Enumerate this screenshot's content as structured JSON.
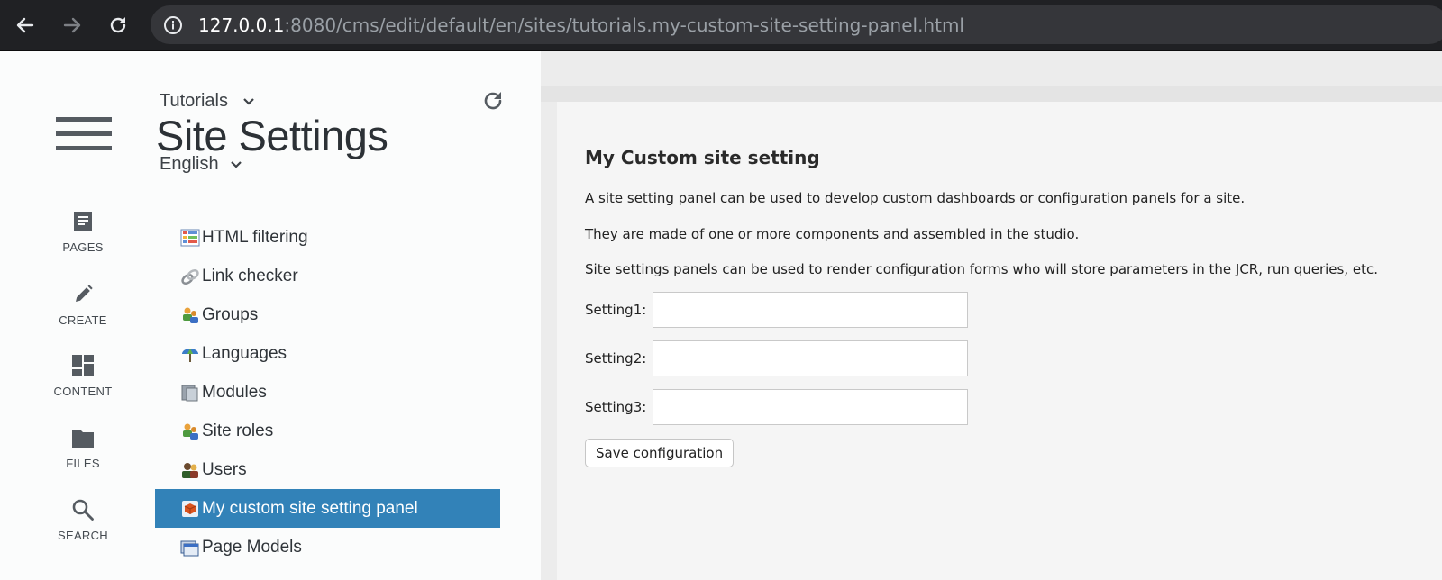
{
  "browser": {
    "url_host": "127.0.0.1",
    "url_rest": ":8080/cms/edit/default/en/sites/tutorials.my-custom-site-setting-panel.html",
    "icons": [
      "back-arrow-icon",
      "forward-arrow-icon",
      "reload-icon",
      "info-icon"
    ]
  },
  "nav": {
    "items": [
      {
        "label": "PAGES",
        "icon": "pages-icon"
      },
      {
        "label": "CREATE",
        "icon": "pencil-icon"
      },
      {
        "label": "CONTENT",
        "icon": "dashboard-icon"
      },
      {
        "label": "FILES",
        "icon": "folder-icon"
      },
      {
        "label": "SEARCH",
        "icon": "search-icon"
      }
    ]
  },
  "panel": {
    "site": "Tutorials",
    "title": "Site Settings",
    "language": "English",
    "items": [
      {
        "label": "HTML filtering",
        "icon": "html-filtering-icon"
      },
      {
        "label": "Link checker",
        "icon": "link-checker-icon"
      },
      {
        "label": "Groups",
        "icon": "groups-icon"
      },
      {
        "label": "Languages",
        "icon": "languages-icon"
      },
      {
        "label": "Modules",
        "icon": "modules-icon"
      },
      {
        "label": "Site roles",
        "icon": "site-roles-icon"
      },
      {
        "label": "Users",
        "icon": "users-icon"
      },
      {
        "label": "My custom site setting panel",
        "icon": "custom-panel-icon",
        "active": true
      },
      {
        "label": "Page Models",
        "icon": "page-models-icon"
      }
    ]
  },
  "content": {
    "title": "My Custom site setting",
    "paragraphs": [
      "A site setting panel can be used to develop custom dashboards or configuration panels for a site.",
      "They are made of one or more components and assembled in the studio.",
      "Site settings panels can be used to render configuration forms who will store parameters in the JCR, run queries, etc."
    ],
    "fields": [
      {
        "label": "Setting1:",
        "value": ""
      },
      {
        "label": "Setting2:",
        "value": ""
      },
      {
        "label": "Setting3:",
        "value": ""
      }
    ],
    "save_label": "Save configuration"
  },
  "colors": {
    "active_item": "#3282b8",
    "browser_bar": "#202124"
  }
}
